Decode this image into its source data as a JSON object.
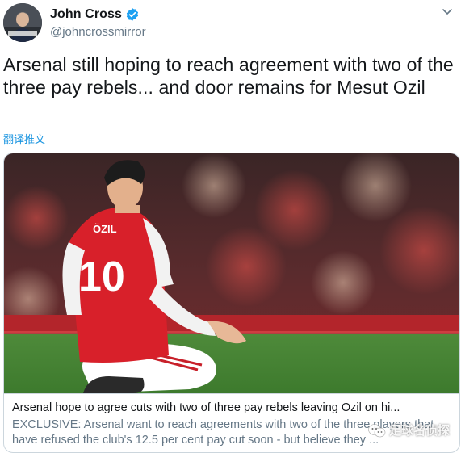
{
  "author": {
    "display_name": "John Cross",
    "handle": "@johncrossmirror",
    "verified": true
  },
  "tweet": {
    "text": "Arsenal still hoping to reach agreement with two of the three pay rebels... and door remains for Mesut Ozil",
    "translate_label": "翻译推文"
  },
  "card": {
    "jersey_name": "ÖZIL",
    "jersey_number": "10",
    "title": "Arsenal hope to agree cuts with two of three pay rebels leaving Ozil on hi...",
    "description": "EXCLUSIVE: Arsenal want to reach agreements with two of the three players that have refused the club's 12.5 per cent pay cut soon - but believe they ..."
  },
  "watermark": {
    "text": "足球名侦探"
  },
  "colors": {
    "accent": "#1da1f2",
    "link": "#1b95e0",
    "text_primary": "#14171a",
    "text_secondary": "#657786",
    "jersey_red": "#d8202a"
  },
  "icons": [
    "avatar",
    "verified-badge-icon",
    "chevron-down-icon",
    "wechat-icon"
  ]
}
